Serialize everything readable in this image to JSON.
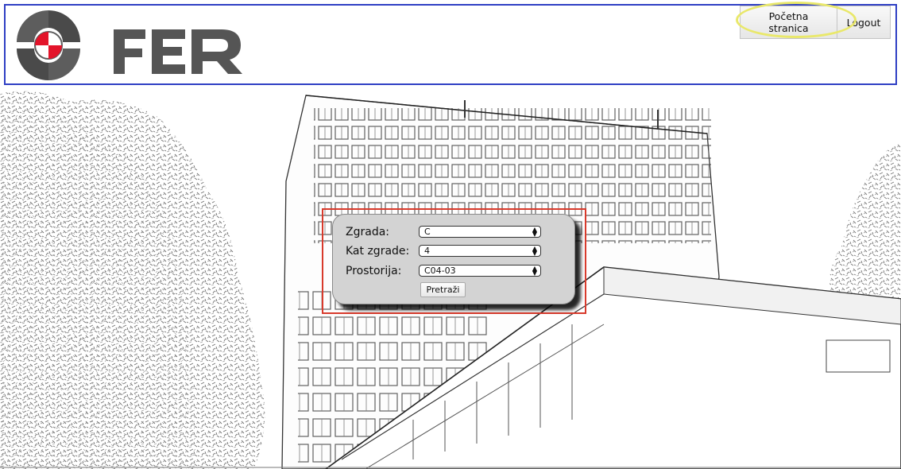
{
  "header": {
    "logo_alt": "FER",
    "home_label": "Početna stranica",
    "logout_label": "Logout"
  },
  "form": {
    "building": {
      "label": "Zgrada:",
      "value": "C"
    },
    "floor": {
      "label": "Kat zgrade:",
      "value": "4"
    },
    "room": {
      "label": "Prostorija:",
      "value": "C04-03"
    },
    "search_label": "Pretraži"
  },
  "colors": {
    "header_border": "#2f3fc4",
    "panel_highlight": "#d83a2c",
    "button_highlight": "#e9e86a",
    "logo_red": "#e3142a",
    "logo_gray": "#5d5d5d"
  }
}
